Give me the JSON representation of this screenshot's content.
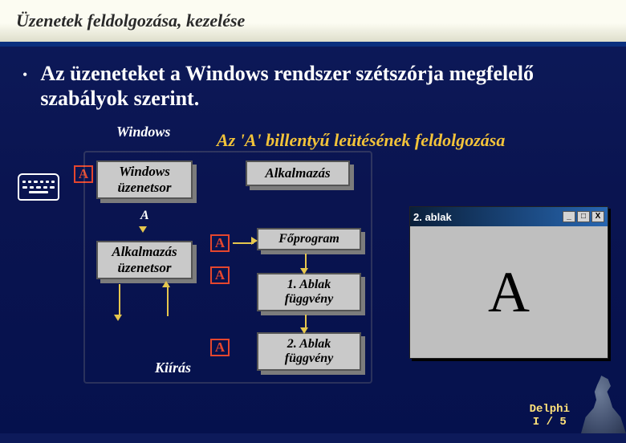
{
  "title": "Üzenetek feldolgozása, kezelése",
  "bullet": "Az üzeneteket a Windows rendszer szétszórja megfelelő szabályok szerint.",
  "windows_label": "Windows",
  "subtitle": "Az 'A' billentyű leütésének feldolgozása",
  "key_letter": "A",
  "boxes": {
    "win_queue": "Windows üzenetsor",
    "app": "Alkalmazás",
    "app_queue": "Alkalmazás üzenetsor",
    "mainprog": "Főprogram",
    "winfunc1": "1. Ablak függvény",
    "winfunc2": "2. Ablak függvény"
  },
  "kiiras": "Kiírás",
  "window": {
    "title": "2. ablak",
    "min": "_",
    "max": "□",
    "close": "X",
    "bigA": "A"
  },
  "footer": {
    "line1": "Delphi",
    "line2": "I / 5"
  }
}
